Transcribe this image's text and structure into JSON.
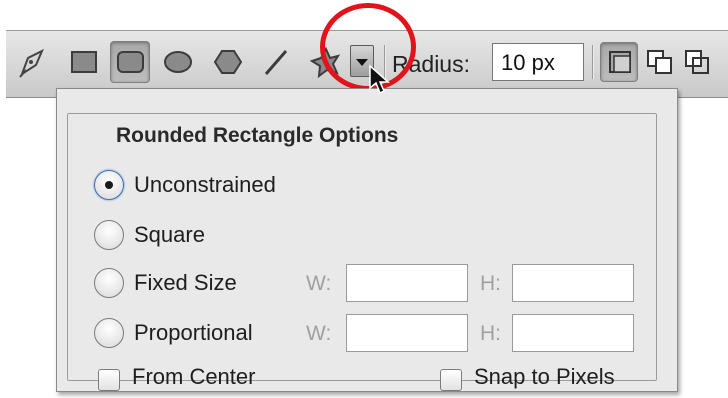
{
  "toolbar": {
    "tools": [
      {
        "name": "pen-tool",
        "icon": "pen-icon",
        "active": false
      },
      {
        "name": "rectangle-tool",
        "icon": "rectangle-icon",
        "active": false
      },
      {
        "name": "rounded-rectangle-tool",
        "icon": "rounded-rectangle-icon",
        "active": true
      },
      {
        "name": "ellipse-tool",
        "icon": "ellipse-icon",
        "active": false
      },
      {
        "name": "polygon-tool",
        "icon": "polygon-icon",
        "active": false
      },
      {
        "name": "line-tool",
        "icon": "line-icon",
        "active": false
      },
      {
        "name": "custom-shape-tool",
        "icon": "custom-shape-icon",
        "active": false
      }
    ],
    "geometry_options_icon": "chevron-down-icon",
    "radius_label": "Radius:",
    "radius_value": "10 px",
    "mode_icons": [
      "new-layer-icon",
      "add-to-shape-icon",
      "subtract-shape-icon"
    ],
    "highlight_color": "#e0141a"
  },
  "options": {
    "title": "Rounded Rectangle Options",
    "radios": [
      {
        "label": "Unconstrained",
        "checked": true
      },
      {
        "label": "Square",
        "checked": false
      },
      {
        "label": "Fixed Size",
        "checked": false
      },
      {
        "label": "Proportional",
        "checked": false
      }
    ],
    "w_label": "W:",
    "h_label": "H:",
    "from_center_label": "From Center",
    "from_center_checked": false,
    "snap_label": "Snap to Pixels",
    "snap_checked": false
  }
}
